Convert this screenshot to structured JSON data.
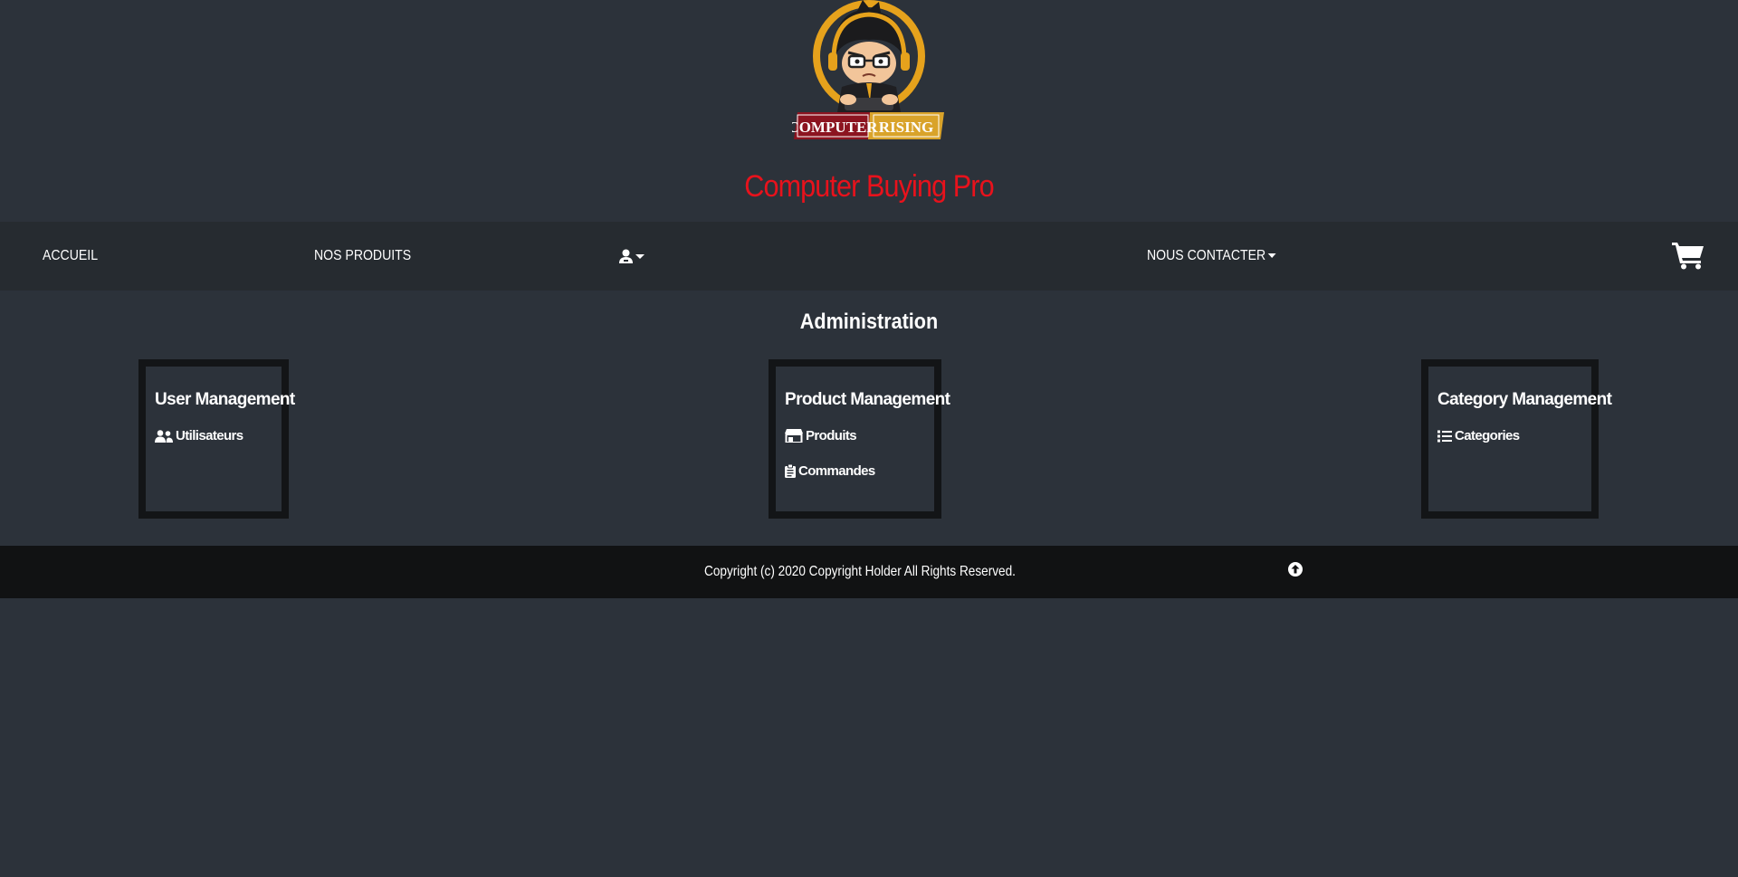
{
  "header": {
    "logo_text_left": "COMPUTER",
    "logo_text_right": "RISING",
    "site_title": "Computer Buying Pro"
  },
  "navbar": {
    "home": "ACCUEIL",
    "products": "NOS PRODUITS",
    "user_menu_icon": "user-icon",
    "contact": "NOUS CONTACTER",
    "cart_icon": "shopping-cart-icon"
  },
  "main": {
    "title": "Administration",
    "cards": [
      {
        "title": "User Management",
        "links": [
          {
            "label": "Utilisateurs",
            "icon": "users-icon"
          }
        ]
      },
      {
        "title": "Product Management",
        "links": [
          {
            "label": "Produits",
            "icon": "store-icon"
          },
          {
            "label": "Commandes",
            "icon": "clipboard-icon"
          }
        ]
      },
      {
        "title": "Category Management",
        "links": [
          {
            "label": "Categories",
            "icon": "list-icon"
          }
        ]
      }
    ]
  },
  "footer": {
    "copyright": "Copyright (c) 2020 Copyright Holder All Rights Reserved.",
    "to_top_icon": "arrow-up-circle-icon"
  },
  "colors": {
    "background": "#2c323a",
    "navbar": "#262b30",
    "footer": "#111213",
    "title_red": "#e8121c",
    "card_border": "#131517"
  }
}
